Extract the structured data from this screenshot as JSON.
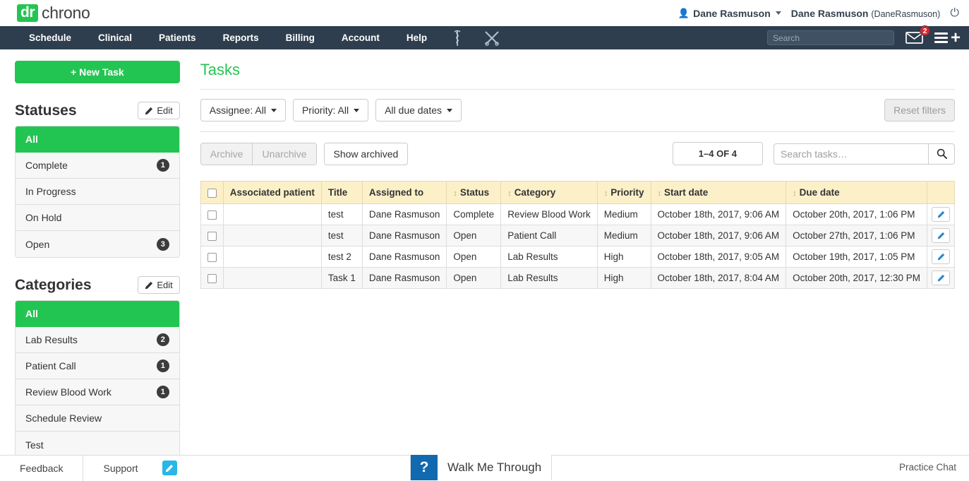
{
  "brand": {
    "logo_dr": "dr",
    "logo_chrono": "chrono",
    "person_icon": "person-icon",
    "user_menu_label": "Dane Rasmuson",
    "user_full_name": "Dane Rasmuson",
    "user_username": "(DaneRasmuson)",
    "power_icon": "power-icon"
  },
  "nav": {
    "items": [
      {
        "label": "Schedule"
      },
      {
        "label": "Clinical"
      },
      {
        "label": "Patients"
      },
      {
        "label": "Reports"
      },
      {
        "label": "Billing"
      },
      {
        "label": "Account"
      },
      {
        "label": "Help"
      }
    ],
    "icons": [
      {
        "name": "caduceus-icon"
      },
      {
        "name": "crossed-instruments-icon"
      }
    ],
    "search_placeholder": "Search",
    "search_value": "",
    "mail_icon": "envelope-icon",
    "mail_badge": "2",
    "menu_icon": "hamburger-icon",
    "plus_icon": "plus-icon"
  },
  "sidebar": {
    "new_task_label": "+ New Task",
    "statuses": {
      "title": "Statuses",
      "edit_label": "Edit",
      "items": [
        {
          "label": "All",
          "count": "",
          "active": true
        },
        {
          "label": "Complete",
          "count": "1",
          "active": false
        },
        {
          "label": "In Progress",
          "count": "",
          "active": false
        },
        {
          "label": "On Hold",
          "count": "",
          "active": false
        },
        {
          "label": "Open",
          "count": "3",
          "active": false
        }
      ]
    },
    "categories": {
      "title": "Categories",
      "edit_label": "Edit",
      "items": [
        {
          "label": "All",
          "count": "",
          "active": true
        },
        {
          "label": "Lab Results",
          "count": "2",
          "active": false
        },
        {
          "label": "Patient Call",
          "count": "1",
          "active": false
        },
        {
          "label": "Review Blood Work",
          "count": "1",
          "active": false
        },
        {
          "label": "Schedule Review",
          "count": "",
          "active": false
        },
        {
          "label": "Test",
          "count": "",
          "active": false
        }
      ]
    }
  },
  "main": {
    "title": "Tasks",
    "filters": [
      {
        "label": "Assignee: All"
      },
      {
        "label": "Priority: All"
      },
      {
        "label": "All due dates"
      }
    ],
    "reset_filters_label": "Reset filters",
    "archive_label": "Archive",
    "unarchive_label": "Unarchive",
    "show_archived_label": "Show archived",
    "count_label": "1–4 OF 4",
    "search_placeholder": "Search tasks…",
    "search_value": "",
    "search_icon": "search-icon"
  },
  "table": {
    "columns": [
      {
        "label": "Associated patient",
        "sortable": false
      },
      {
        "label": "Title",
        "sortable": false
      },
      {
        "label": "Assigned to",
        "sortable": false
      },
      {
        "label": "Status",
        "sortable": true
      },
      {
        "label": "Category",
        "sortable": true
      },
      {
        "label": "Priority",
        "sortable": true
      },
      {
        "label": "Start date",
        "sortable": true
      },
      {
        "label": "Due date",
        "sortable": true
      }
    ],
    "rows": [
      {
        "associated_patient": "",
        "title": "test",
        "assigned_to": "Dane Rasmuson",
        "status": "Complete",
        "category": "Review Blood Work",
        "priority": "Medium",
        "start_date": "October 18th, 2017, 9:06 AM",
        "due_date": "October 20th, 2017, 1:06 PM"
      },
      {
        "associated_patient": "",
        "title": "test",
        "assigned_to": "Dane Rasmuson",
        "status": "Open",
        "category": "Patient Call",
        "priority": "Medium",
        "start_date": "October 18th, 2017, 9:06 AM",
        "due_date": "October 27th, 2017, 1:06 PM"
      },
      {
        "associated_patient": "",
        "title": "test 2",
        "assigned_to": "Dane Rasmuson",
        "status": "Open",
        "category": "Lab Results",
        "priority": "High",
        "start_date": "October 18th, 2017, 9:05 AM",
        "due_date": "October 19th, 2017, 1:05 PM"
      },
      {
        "associated_patient": "",
        "title": "Task 1",
        "assigned_to": "Dane Rasmuson",
        "status": "Open",
        "category": "Lab Results",
        "priority": "High",
        "start_date": "October 18th, 2017, 8:04 AM",
        "due_date": "October 20th, 2017, 12:30 PM"
      }
    ],
    "row_edit_icon": "pencil-icon"
  },
  "footer": {
    "feedback_label": "Feedback",
    "support_label": "Support",
    "support_pencil_icon": "pencil-icon",
    "walkme_q": "?",
    "walkme_label": "Walk Me Through",
    "practice_chat_label": "Practice Chat"
  },
  "colors": {
    "brand_green": "#23c552",
    "nav_dark": "#2e3e4e",
    "table_header": "#fcf0c8",
    "badge_red": "#d9272d",
    "edit_blue": "#2b85cf",
    "walkme_blue": "#1169b0",
    "support_blue": "#29b6e8"
  }
}
